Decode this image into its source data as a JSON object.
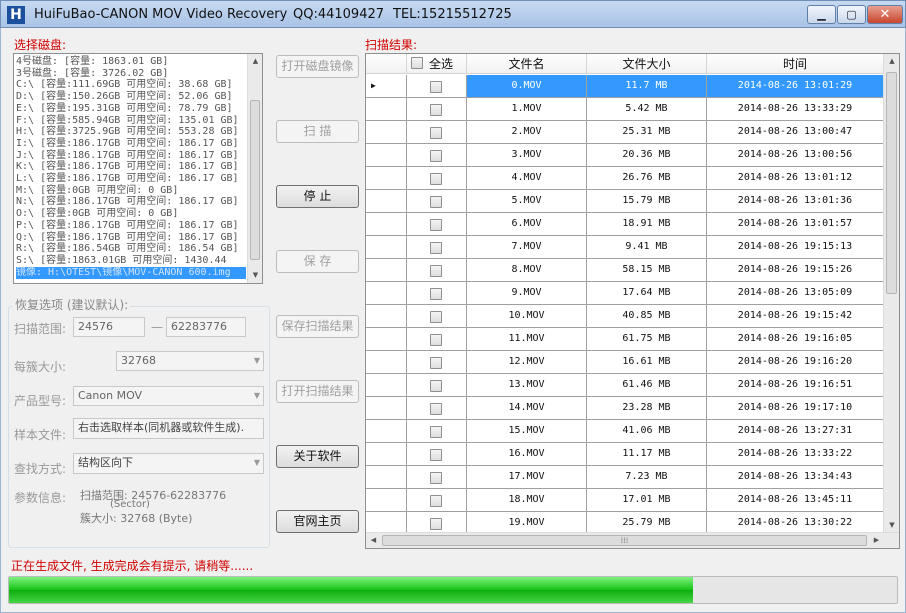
{
  "titlebar": {
    "app_name": "HuiFuBao-CANON MOV Video Recovery",
    "qq": "QQ:44109427",
    "tel": "TEL:15215512725",
    "minimize_icon": "minimize-icon",
    "maximize_icon": "maximize-icon",
    "close_icon": "close-icon",
    "app_icon_glyph": "H"
  },
  "disk_panel": {
    "label": "选择磁盘:",
    "items": [
      "4号磁盘: [容量: 1863.01 GB]",
      "3号磁盘: [容量: 3726.02 GB]",
      "C:\\ [容量:111.69GB 可用空间: 38.68 GB]",
      "D:\\ [容量:150.26GB 可用空间: 52.06 GB]",
      "E:\\ [容量:195.31GB 可用空间: 78.79 GB]",
      "F:\\ [容量:585.94GB 可用空间: 135.01 GB]",
      "H:\\ [容量:3725.9GB 可用空间: 553.28 GB]",
      "I:\\ [容量:186.17GB 可用空间: 186.17 GB]",
      "J:\\ [容量:186.17GB 可用空间: 186.17 GB]",
      "K:\\ [容量:186.17GB 可用空间: 186.17 GB]",
      "L:\\ [容量:186.17GB 可用空间: 186.17 GB]",
      "M:\\ [容量:0GB 可用空间: 0 GB]",
      "N:\\ [容量:186.17GB 可用空间: 186.17 GB]",
      "O:\\ [容量:0GB 可用空间: 0 GB]",
      "P:\\ [容量:186.17GB 可用空间: 186.17 GB]",
      "Q:\\ [容量:186.17GB 可用空间: 186.17 GB]",
      "R:\\ [容量:186.54GB 可用空间: 186.54 GB]",
      "S:\\ [容量:1863.01GB 可用空间: 1430.44",
      "镜像: H:\\OTEST\\镜像\\MOV-CANON 600.img"
    ],
    "selected_index": 18
  },
  "options": {
    "group_title": "恢复选项 (建议默认):",
    "scan_range_label": "扫描范围:",
    "scan_start": "24576",
    "range_dash": "—",
    "scan_end": "62283776",
    "cluster_label": "每簇大小:",
    "cluster_value": "32768",
    "product_label": "产品型号:",
    "product_value": "Canon MOV",
    "sample_label": "样本文件:",
    "sample_value": "右击选取样本(同机器或软件生成).",
    "search_label": "查找方式:",
    "search_value": "结构区向下",
    "param_label": "参数信息:",
    "param_range": "扫描范围: 24576-62283776",
    "param_unit": "(Sector)",
    "param_cluster": "簇大小: 32768 (Byte)"
  },
  "buttons": {
    "open_image": "打开磁盘镜像",
    "scan": "扫  描",
    "stop": "停  止",
    "save": "保  存",
    "save_scan": "保存扫描结果",
    "open_scan": "打开扫描结果",
    "about": "关于软件",
    "website": "官网主页"
  },
  "results": {
    "label": "扫描结果:",
    "headers": {
      "select_all": "全选",
      "filename": "文件名",
      "filesize": "文件大小",
      "time": "时间"
    },
    "selected_row": 0,
    "row_pointer": "▶",
    "rows": [
      {
        "name": "0.MOV",
        "size": "11.7 MB",
        "time": "2014-08-26 13:01:29"
      },
      {
        "name": "1.MOV",
        "size": "5.42 MB",
        "time": "2014-08-26 13:33:29"
      },
      {
        "name": "2.MOV",
        "size": "25.31 MB",
        "time": "2014-08-26 13:00:47"
      },
      {
        "name": "3.MOV",
        "size": "20.36 MB",
        "time": "2014-08-26 13:00:56"
      },
      {
        "name": "4.MOV",
        "size": "26.76 MB",
        "time": "2014-08-26 13:01:12"
      },
      {
        "name": "5.MOV",
        "size": "15.79 MB",
        "time": "2014-08-26 13:01:36"
      },
      {
        "name": "6.MOV",
        "size": "18.91 MB",
        "time": "2014-08-26 13:01:57"
      },
      {
        "name": "7.MOV",
        "size": "9.41 MB",
        "time": "2014-08-26 19:15:13"
      },
      {
        "name": "8.MOV",
        "size": "58.15 MB",
        "time": "2014-08-26 19:15:26"
      },
      {
        "name": "9.MOV",
        "size": "17.64 MB",
        "time": "2014-08-26 13:05:09"
      },
      {
        "name": "10.MOV",
        "size": "40.85 MB",
        "time": "2014-08-26 19:15:42"
      },
      {
        "name": "11.MOV",
        "size": "61.75 MB",
        "time": "2014-08-26 19:16:05"
      },
      {
        "name": "12.MOV",
        "size": "16.61 MB",
        "time": "2014-08-26 19:16:20"
      },
      {
        "name": "13.MOV",
        "size": "61.46 MB",
        "time": "2014-08-26 19:16:51"
      },
      {
        "name": "14.MOV",
        "size": "23.28 MB",
        "time": "2014-08-26 19:17:10"
      },
      {
        "name": "15.MOV",
        "size": "41.06 MB",
        "time": "2014-08-26 13:27:31"
      },
      {
        "name": "16.MOV",
        "size": "11.17 MB",
        "time": "2014-08-26 13:33:22"
      },
      {
        "name": "17.MOV",
        "size": "7.23 MB",
        "time": "2014-08-26 13:34:43"
      },
      {
        "name": "18.MOV",
        "size": "17.01 MB",
        "time": "2014-08-26 13:45:11"
      },
      {
        "name": "19.MOV",
        "size": "25.79 MB",
        "time": "2014-08-26 13:30:22"
      }
    ]
  },
  "status": {
    "message": "正在生成文件, 生成完成会有提示, 请稍等......",
    "progress": 0.77
  },
  "colors": {
    "accent": "#3399ff",
    "warning_text": "#d10000",
    "progress": "#16c116"
  }
}
